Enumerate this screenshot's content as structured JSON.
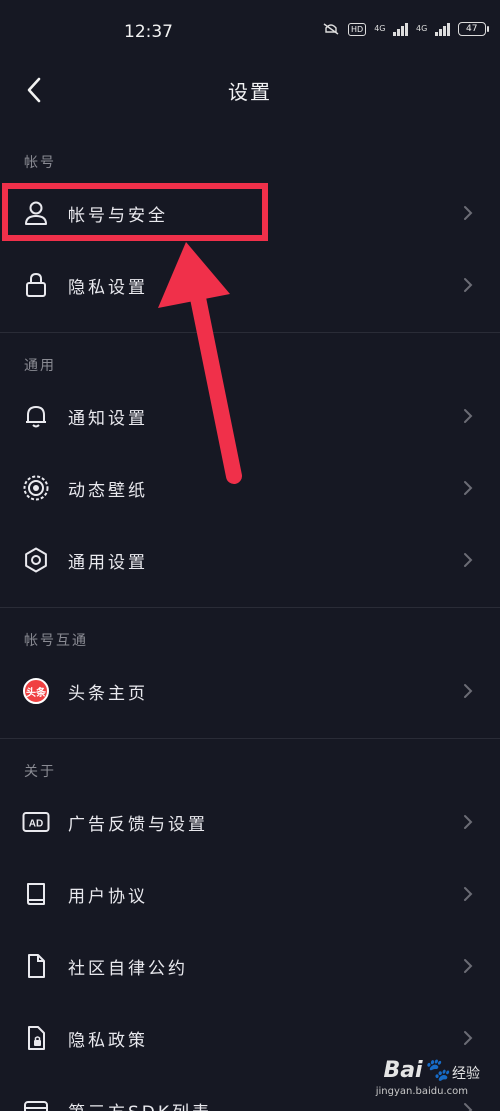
{
  "status_bar": {
    "time": "12:37",
    "hd_label": "HD",
    "network_1": "4G",
    "network_2": "4G",
    "battery": "47"
  },
  "header": {
    "title": "设置",
    "back_icon": "chevron-left-icon"
  },
  "sections": {
    "account": "帐号",
    "general": "通用",
    "linked": "帐号互通",
    "about": "关于"
  },
  "items": {
    "account_security": "帐号与安全",
    "privacy_settings": "隐私设置",
    "notification_settings": "通知设置",
    "live_wallpaper": "动态壁纸",
    "general_settings": "通用设置",
    "toutiao_home": "头条主页",
    "ad_feedback": "广告反馈与设置",
    "user_agreement": "用户协议",
    "community_rules": "社区自律公约",
    "privacy_policy": "隐私政策",
    "third_party_sdk": "第三方SDK列表"
  },
  "icons": {
    "toutiao_badge": "头条",
    "ad_badge": "AD"
  },
  "annotation": {
    "highlight_color": "#f0304a"
  },
  "watermark": {
    "logo": "Bai🐾",
    "text": "经验",
    "url": "jingyan.baidu.com"
  },
  "colors": {
    "background": "#161823",
    "text": "#e9e9ee",
    "section": "#8a8b93"
  }
}
